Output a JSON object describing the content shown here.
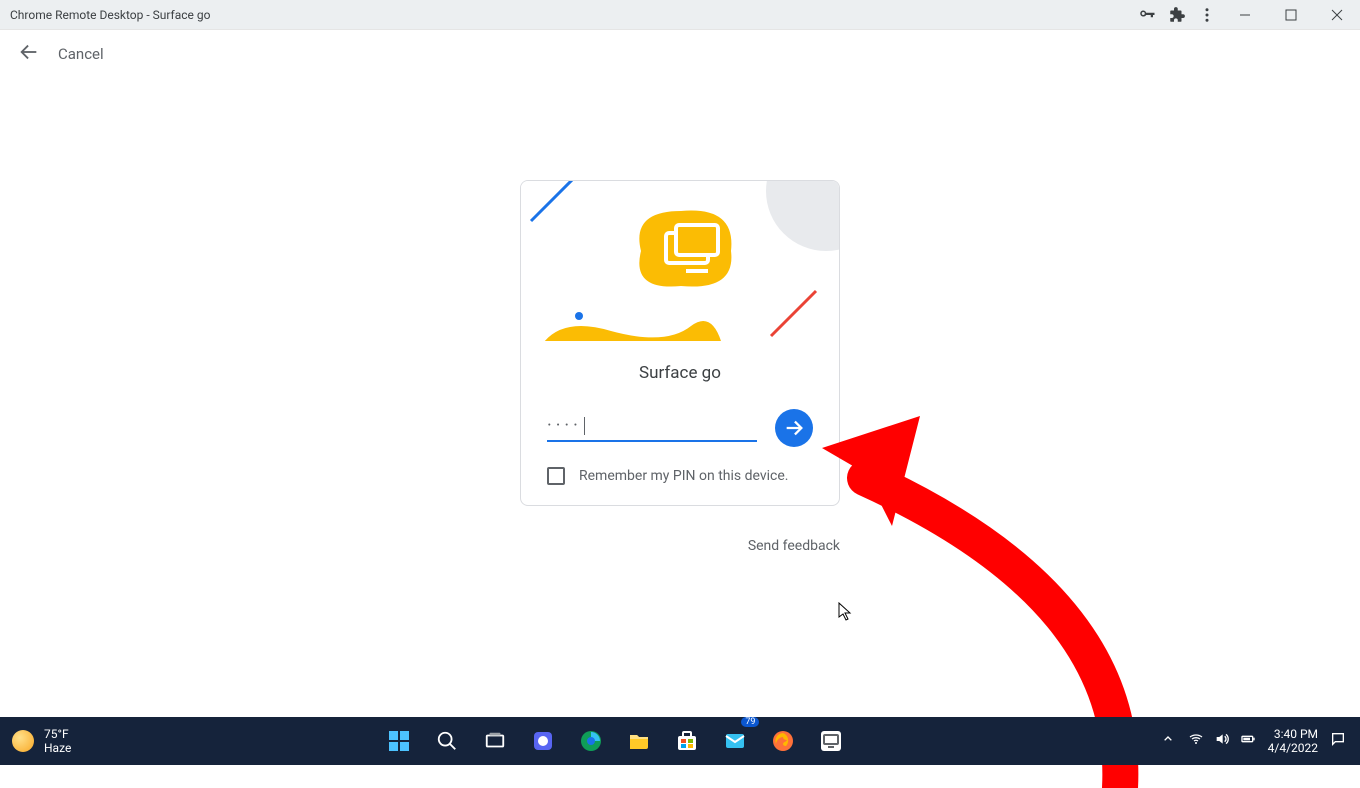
{
  "window": {
    "title": "Chrome Remote Desktop - Surface go"
  },
  "subbar": {
    "cancel_label": "Cancel"
  },
  "card": {
    "device_name": "Surface go",
    "pin_value": "····",
    "remember_label": "Remember my PIN on this device."
  },
  "feedback_label": "Send feedback",
  "taskbar": {
    "weather_temp": "75°F",
    "weather_cond": "Haze",
    "mail_badge": "79",
    "time": "3:40 PM",
    "date": "4/4/2022"
  }
}
